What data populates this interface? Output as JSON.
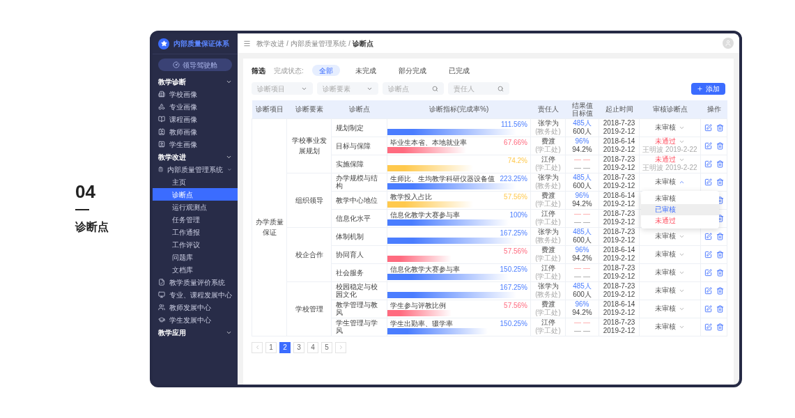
{
  "section_marker": {
    "number": "04",
    "title": "诊断点"
  },
  "sidebar": {
    "brand": "内部质量保证体系",
    "cockpit_button": "领导驾驶舱",
    "sections": [
      {
        "label": "教学诊断",
        "expanded": true,
        "items": [
          {
            "label": "学校画像",
            "selected": false
          },
          {
            "label": "专业画像",
            "selected": false
          },
          {
            "label": "课程画像",
            "selected": false
          },
          {
            "label": "教师画像",
            "selected": false
          },
          {
            "label": "学生画像",
            "selected": false
          }
        ]
      },
      {
        "label": "教学改进",
        "expanded": true,
        "items": [
          {
            "label": "内部质量管理系统",
            "selected": false,
            "expanded": true,
            "children": [
              {
                "label": "主页",
                "selected": false
              },
              {
                "label": "诊断点",
                "selected": true
              },
              {
                "label": "运行观测点",
                "selected": false
              },
              {
                "label": "任务管理",
                "selected": false
              },
              {
                "label": "工作通报",
                "selected": false
              },
              {
                "label": "工作评议",
                "selected": false
              },
              {
                "label": "问题库",
                "selected": false
              },
              {
                "label": "文档库",
                "selected": false
              }
            ]
          },
          {
            "label": "教学质量评价系统",
            "selected": false
          },
          {
            "label": "专业、课程发展中心",
            "selected": false
          },
          {
            "label": "教师发展中心",
            "selected": false
          },
          {
            "label": "学生发展中心",
            "selected": false
          }
        ]
      },
      {
        "label": "教学应用",
        "expanded": true
      }
    ]
  },
  "breadcrumb": [
    "教学改进",
    "内部质量管理系统",
    "诊断点"
  ],
  "filter": {
    "title": "筛选",
    "status_label": "完成状态:",
    "status_tabs": [
      {
        "label": "全部",
        "selected": true
      },
      {
        "label": "未完成",
        "selected": false
      },
      {
        "label": "部分完成",
        "selected": false
      },
      {
        "label": "已完成",
        "selected": false
      }
    ],
    "fields": [
      {
        "kind": "select",
        "placeholder": "诊断项目"
      },
      {
        "kind": "select",
        "placeholder": "诊断要素"
      },
      {
        "kind": "search",
        "placeholder": "诊断点"
      },
      {
        "kind": "search",
        "placeholder": "责任人"
      }
    ],
    "add_button": "添加"
  },
  "table": {
    "columns": [
      "诊断项目",
      "诊断要素",
      "诊断点",
      "诊断指标(完成率%)",
      "责任人",
      "结果值",
      "目标值",
      "起止时间",
      "审核诊断点",
      "操作"
    ],
    "review_menu": [
      {
        "label": "未审核",
        "kind": "pending",
        "selected": false
      },
      {
        "label": "已审核",
        "kind": "approved",
        "selected": true
      },
      {
        "label": "未通过",
        "kind": "rejected",
        "selected": false
      }
    ],
    "groups": [
      {
        "project": "办学质量保证",
        "elements": [
          {
            "name": "学校事业发展规划",
            "points": [
              {
                "name": "规划制定",
                "indicator": {
                  "percent": "111.56%",
                  "color": "#4a7dff",
                  "level": 0.9
                },
                "owner": {
                  "name": "张学为",
                  "dept": "(教务处)"
                },
                "result": {
                  "value": "485人",
                  "target": "600人",
                  "kind": "filled"
                },
                "dates": [
                  "2018-7-23",
                  "2019-2-12"
                ],
                "review": {
                  "kind": "pending",
                  "label": "未审核",
                  "open": false
                }
              },
              {
                "name": "目标与保障",
                "indicator": {
                  "label": "毕业生本省、本地就业率",
                  "percent": "67.66%",
                  "color": "#ff6b7f",
                  "level": 0.55
                },
                "owner": {
                  "name": "费渡",
                  "dept": "(学工处)"
                },
                "result": {
                  "value": "96%",
                  "target": "94.2%",
                  "kind": "filled"
                },
                "dates": [
                  "2018-6-14",
                  "2019-2-12"
                ],
                "review": {
                  "kind": "rejected",
                  "label": "未通过",
                  "note": "王明波 2019-2-22",
                  "open": false
                }
              },
              {
                "name": "实施保障",
                "indicator": {
                  "percent": "74.2%",
                  "color": "#ffc94d",
                  "level": 0.6
                },
                "owner": {
                  "name": "江停",
                  "dept": "(学工处)"
                },
                "result": {
                  "value": "— —",
                  "target": "— —",
                  "kind": "empty"
                },
                "dates": [
                  "2018-7-23",
                  "2019-2-12"
                ],
                "review": {
                  "kind": "rejected",
                  "label": "未通过",
                  "note": "王明波 2019-2-22",
                  "open": false
                }
              }
            ]
          },
          {
            "name": "组织领导",
            "points": [
              {
                "name": "办学规模与结构",
                "indicator": {
                  "label": "生师比、生均教学科研仪器设备值",
                  "percent": "223.25%",
                  "color": "#4a7dff",
                  "level": 0.9
                },
                "owner": {
                  "name": "张学为",
                  "dept": "(教务处)"
                },
                "result": {
                  "value": "485人",
                  "target": "600人",
                  "kind": "filled"
                },
                "dates": [
                  "2018-7-23",
                  "2019-2-12"
                ],
                "review": {
                  "kind": "pending",
                  "label": "未审核",
                  "open": true
                }
              },
              {
                "name": "教学中心地位",
                "indicator": {
                  "label": "教学投入占比",
                  "percent": "57.56%",
                  "color": "#ffc94d",
                  "level": 0.6
                },
                "owner": {
                  "name": "费渡",
                  "dept": "(学工处)"
                },
                "result": {
                  "value": "96%",
                  "target": "94.2%",
                  "kind": "filled"
                },
                "dates": [
                  "2018-6-14",
                  "2019-2-12"
                ]
              },
              {
                "name": "信息化水平",
                "indicator": {
                  "label": "信息化教学大赛参与率",
                  "percent": "100%",
                  "color": "#4a7dff",
                  "level": 0.85
                },
                "owner": {
                  "name": "江停",
                  "dept": "(学工处)"
                },
                "result": {
                  "value": "— —",
                  "target": "— —",
                  "kind": "empty"
                },
                "dates": [
                  "2018-7-23",
                  "2019-2-12"
                ]
              }
            ]
          },
          {
            "name": "校企合作",
            "points": [
              {
                "name": "体制机制",
                "indicator": {
                  "percent": "167.25%",
                  "color": "#4a7dff",
                  "level": 0.9
                },
                "owner": {
                  "name": "张学为",
                  "dept": "(教务处)"
                },
                "result": {
                  "value": "485人",
                  "target": "600人",
                  "kind": "filled"
                },
                "dates": [
                  "2018-7-23",
                  "2019-2-12"
                ],
                "review": {
                  "kind": "pending",
                  "label": "未审核",
                  "open": false
                }
              },
              {
                "name": "协同育人",
                "indicator": {
                  "percent": "57.56%",
                  "color": "#ff6b7f",
                  "level": 0.45
                },
                "owner": {
                  "name": "费渡",
                  "dept": "(学工处)"
                },
                "result": {
                  "value": "96%",
                  "target": "94.2%",
                  "kind": "filled"
                },
                "dates": [
                  "2018-6-14",
                  "2019-2-12"
                ],
                "review": {
                  "kind": "pending",
                  "label": "未审核",
                  "open": false
                }
              },
              {
                "name": "社会服务",
                "indicator": {
                  "label": "信息化教学大赛参与率",
                  "percent": "150.25%",
                  "color": "#4a7dff",
                  "level": 0.85
                },
                "owner": {
                  "name": "江停",
                  "dept": "(学工处)"
                },
                "result": {
                  "value": "— —",
                  "target": "— —",
                  "kind": "empty"
                },
                "dates": [
                  "2018-7-23",
                  "2019-2-12"
                ],
                "review": {
                  "kind": "pending",
                  "label": "未审核",
                  "open": false
                }
              }
            ]
          },
          {
            "name": "学校管理",
            "points": [
              {
                "name": "校园稳定与校园文化",
                "indicator": {
                  "percent": "167.25%",
                  "color": "#4a7dff",
                  "level": 0.9
                },
                "owner": {
                  "name": "张学为",
                  "dept": "(教务处)"
                },
                "result": {
                  "value": "485人",
                  "target": "600人",
                  "kind": "filled"
                },
                "dates": [
                  "2018-7-23",
                  "2019-2-12"
                ],
                "review": {
                  "kind": "pending",
                  "label": "未审核",
                  "open": false
                }
              },
              {
                "name": "教学管理与教风",
                "indicator": {
                  "label": "学生参与评教比例",
                  "percent": "57.56%",
                  "color": "#ff6b7f",
                  "level": 0.45
                },
                "owner": {
                  "name": "费渡",
                  "dept": "(学工处)"
                },
                "result": {
                  "value": "96%",
                  "target": "94.2%",
                  "kind": "filled"
                },
                "dates": [
                  "2018-6-14",
                  "2019-2-12"
                ],
                "review": {
                  "kind": "pending",
                  "label": "未审核",
                  "open": false
                }
              },
              {
                "name": "学生管理与学风",
                "indicator": {
                  "label": "学生出勤率、辍学率",
                  "percent": "150.25%",
                  "color": "#4a7dff",
                  "level": 0.7
                },
                "owner": {
                  "name": "江停",
                  "dept": "(学工处)"
                },
                "result": {
                  "value": "— —",
                  "target": "— —",
                  "kind": "empty"
                },
                "dates": [
                  "2018-7-23",
                  "2019-2-12"
                ],
                "review": {
                  "kind": "pending",
                  "label": "未审核",
                  "open": false
                }
              }
            ]
          }
        ]
      }
    ]
  },
  "pagination": {
    "pages": [
      {
        "label": "1",
        "selected": false
      },
      {
        "label": "2",
        "selected": true
      },
      {
        "label": "3",
        "selected": false
      },
      {
        "label": "4",
        "selected": false
      },
      {
        "label": "5",
        "selected": false
      }
    ]
  }
}
